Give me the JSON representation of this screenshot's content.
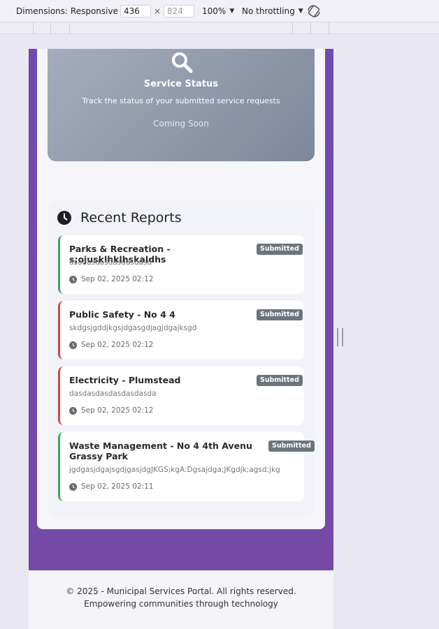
{
  "devtools": {
    "dimensions_label": "Dimensions: Responsive",
    "width_value": "436",
    "times": "×",
    "height_placeholder": "824",
    "zoom": "100%",
    "throttling": "No throttling"
  },
  "service_status": {
    "icon": "search-icon",
    "title": "Service Status",
    "description": "Track the status of your submitted service requests",
    "cta": "Coming Soon"
  },
  "recent_reports": {
    "icon": "clock-icon",
    "title": "Recent Reports",
    "items": [
      {
        "title": "Parks & Recreation - s;ojusklhklhskaldhs",
        "description": "dsadasdasdasdasdasd",
        "date": "Sep 02, 2025 02:12",
        "status": "Submitted",
        "accent": "#3aa45e"
      },
      {
        "title": "Public Safety - No 4 4",
        "description": "skdgsjgddjkgsjdgasgdjagjdgajksgd",
        "date": "Sep 02, 2025 02:12",
        "status": "Submitted",
        "accent": "#d2464a"
      },
      {
        "title": "Electricity - Plumstead",
        "description": "dasdasdasdasdasdasda",
        "date": "Sep 02, 2025 02:12",
        "status": "Submitted",
        "accent": "#d2464a"
      },
      {
        "title": "Waste Management - No 4 4th Avenu Grassy Park",
        "description": "jgdgasjdgajsgdjgasjdgJKGS;kgA:Dgsajdga;JKgdjk;agsd;jkg",
        "date": "Sep 02, 2025 02:11",
        "status": "Submitted",
        "accent": "#3aa45e"
      }
    ]
  },
  "footer": {
    "copyright": "© 2025 - Municipal Services Portal. All rights reserved.",
    "tagline": "Empowering communities through technology"
  },
  "colors": {
    "purple": "#6f4bb0",
    "badge": "#6c757d",
    "green_accent": "#3aa45e",
    "red_accent": "#d2464a"
  }
}
